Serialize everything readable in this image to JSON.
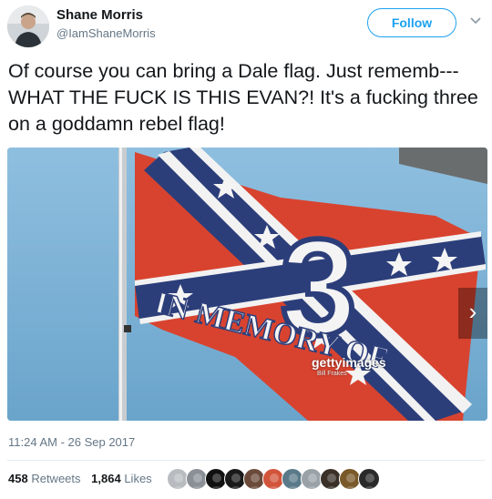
{
  "user": {
    "name": "Shane Morris",
    "handle": "@IamShaneMorris"
  },
  "actions": {
    "follow_label": "Follow"
  },
  "tweet": {
    "text": "Of course you can bring a Dale flag. Just rememb--- WHAT THE FUCK IS THIS EVAN?! It's a fucking three on a goddamn rebel flag!",
    "timestamp": "11:24 AM - 26 Sep 2017"
  },
  "media": {
    "flag_text": "IN MEMORY OF",
    "flag_number": "3",
    "watermark": "gettyimages",
    "watermark_credit": "Bill Frakes",
    "next_arrow": "›"
  },
  "stats": {
    "retweets_count": "458",
    "retweets_label": "Retweets",
    "likes_count": "1,864",
    "likes_label": "Likes"
  },
  "likers": [
    {
      "color": "#b8bcc0"
    },
    {
      "color": "#8a9096"
    },
    {
      "color": "#111111"
    },
    {
      "color": "#1a1a1a"
    },
    {
      "color": "#6b4a3a"
    },
    {
      "color": "#d2543a"
    },
    {
      "color": "#5a7a8a"
    },
    {
      "color": "#9aa2a8"
    },
    {
      "color": "#3a3028"
    },
    {
      "color": "#7a5a2a"
    },
    {
      "color": "#2a2a2a"
    }
  ],
  "colors": {
    "accent": "#1da1f2",
    "sky": "#7cb3d6",
    "flag_red": "#d8432f",
    "flag_blue": "#2c3e7a"
  }
}
